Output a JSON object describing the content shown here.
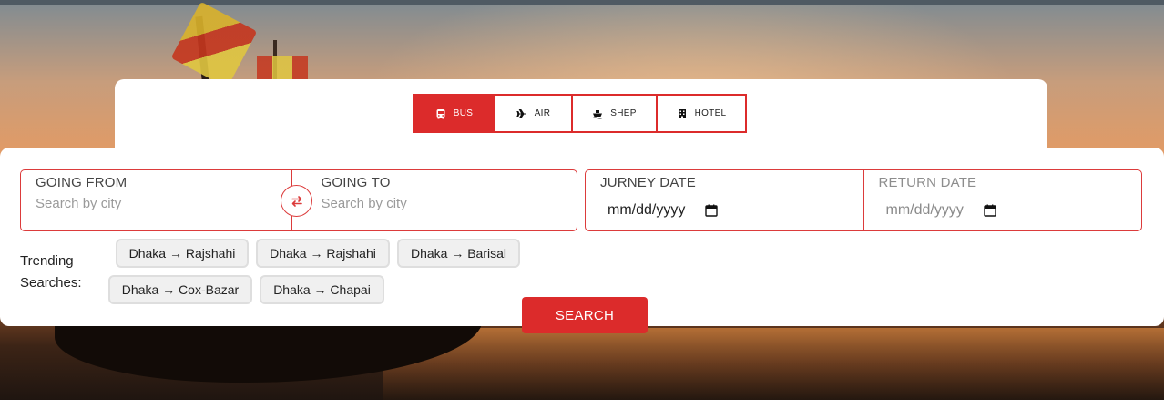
{
  "tabs": [
    {
      "label": "BUS",
      "icon": "bus-icon",
      "active": true
    },
    {
      "label": "AIR",
      "icon": "airplane-icon",
      "active": false
    },
    {
      "label": "SHEP",
      "icon": "ship-icon",
      "active": false
    },
    {
      "label": "HOTEL",
      "icon": "hotel-icon",
      "active": false
    }
  ],
  "route": {
    "from": {
      "label": "GOING FROM",
      "placeholder": "Search by city",
      "value": ""
    },
    "to": {
      "label": "GOING TO",
      "placeholder": "Search by city",
      "value": ""
    },
    "swap_icon": "swap-arrows-icon"
  },
  "dates": {
    "journey": {
      "label": "JURNEY DATE",
      "value": "mm/dd/yyyy",
      "icon": "calendar-icon"
    },
    "return": {
      "label": "RETURN DATE",
      "value": "mm/dd/yyyy",
      "icon": "calendar-icon"
    }
  },
  "trending": {
    "label": "Trending Searches:",
    "items": [
      "Dhaka → Rajshahi",
      "Dhaka → Rajshahi",
      "Dhaka → Barisal",
      "Dhaka → Cox-Bazar",
      "Dhaka → Chapai"
    ]
  },
  "search_button": "SEARCH",
  "colors": {
    "accent": "#dc2b2b",
    "chip_bg": "#f0f0f0",
    "card_bg": "#ffffff"
  }
}
